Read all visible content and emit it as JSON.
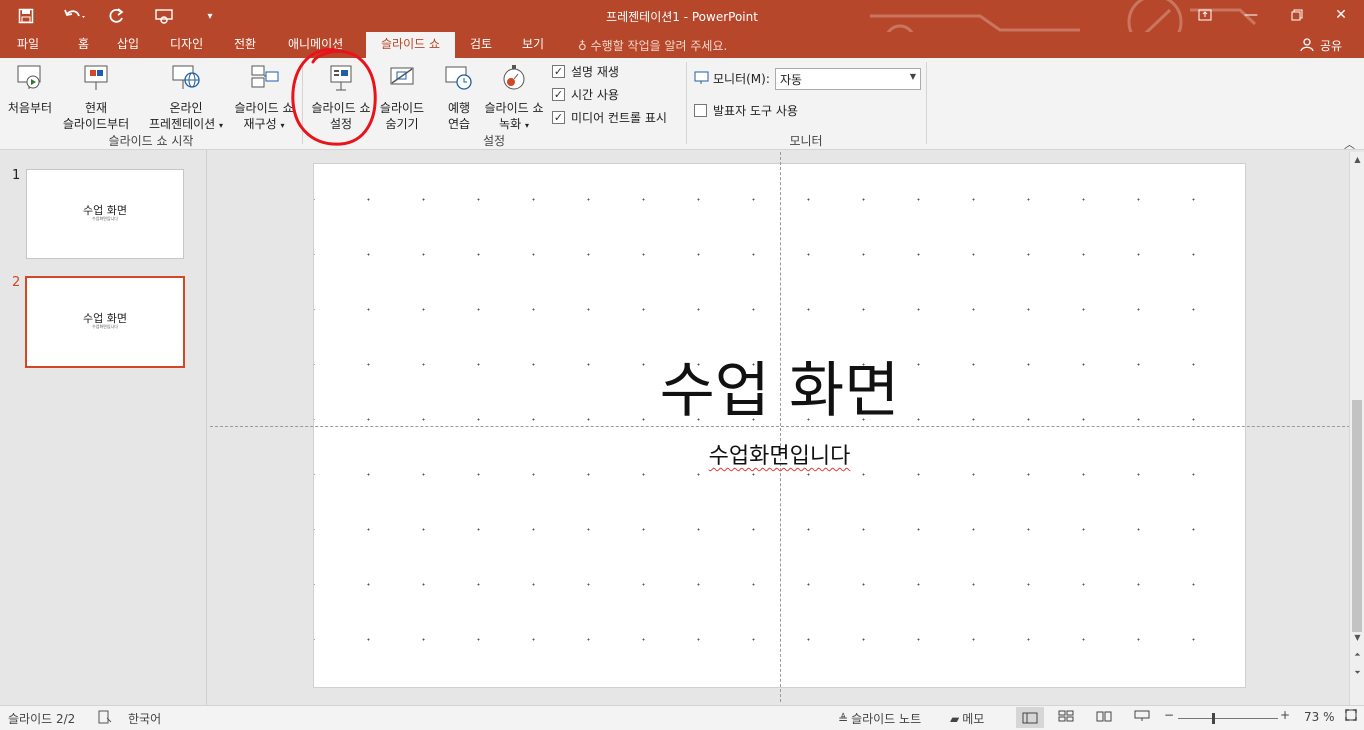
{
  "window": {
    "title": "프레젠테이션1 - PowerPoint"
  },
  "qat": {
    "save_icon": "save-icon",
    "undo_icon": "undo-icon",
    "redo_icon": "redo-icon",
    "present_icon": "present-from-start-icon"
  },
  "tabs": [
    {
      "label": "파일"
    },
    {
      "label": "홈"
    },
    {
      "label": "삽입"
    },
    {
      "label": "디자인"
    },
    {
      "label": "전환"
    },
    {
      "label": "애니메이션"
    },
    {
      "label": "슬라이드 쇼",
      "active": true
    },
    {
      "label": "검토"
    },
    {
      "label": "보기"
    }
  ],
  "tell_me": "수행할 작업을 알려 주세요.",
  "share_label": "공유",
  "ribbon": {
    "start_group": {
      "label": "슬라이드 쇼 시작",
      "from_beginning": [
        "처음부터",
        ""
      ],
      "from_current": [
        "현재",
        "슬라이드부터"
      ],
      "online": [
        "온라인",
        "프레젠테이션"
      ],
      "custom": [
        "슬라이드 쇼",
        "재구성"
      ]
    },
    "setup_group": {
      "label": "설정",
      "setup_show": [
        "슬라이드 쇼",
        "설정"
      ],
      "hide_slide": [
        "슬라이드",
        "숨기기"
      ],
      "rehearse": [
        "예행",
        "연습"
      ],
      "record": [
        "슬라이드 쇼",
        "녹화"
      ],
      "checks": [
        {
          "label": "설명 재생",
          "checked": true
        },
        {
          "label": "시간 사용",
          "checked": true
        },
        {
          "label": "미디어 컨트롤 표시",
          "checked": true
        }
      ]
    },
    "monitor_group": {
      "label": "모니터",
      "monitor_label": "모니터(M):",
      "monitor_value": "자동",
      "presenter_view": {
        "label": "발표자 도구 사용",
        "checked": false
      }
    }
  },
  "slides": [
    {
      "number": "1",
      "title": "수업 화면",
      "subtitle": "수업화면입니다"
    },
    {
      "number": "2",
      "title": "수업 화면",
      "subtitle": "수업화면입니다",
      "selected": true
    }
  ],
  "current_slide": {
    "title": "수업 화면",
    "subtitle": "수업화면입니다"
  },
  "status": {
    "slide_indicator": "슬라이드 2/2",
    "language": "한국어",
    "notes_label": "슬라이드 노트",
    "comments_label": "메모",
    "zoom": "73 %",
    "zoom_level": 0.73
  },
  "colors": {
    "accent": "#b7472a",
    "annotation": "#e8141c"
  }
}
